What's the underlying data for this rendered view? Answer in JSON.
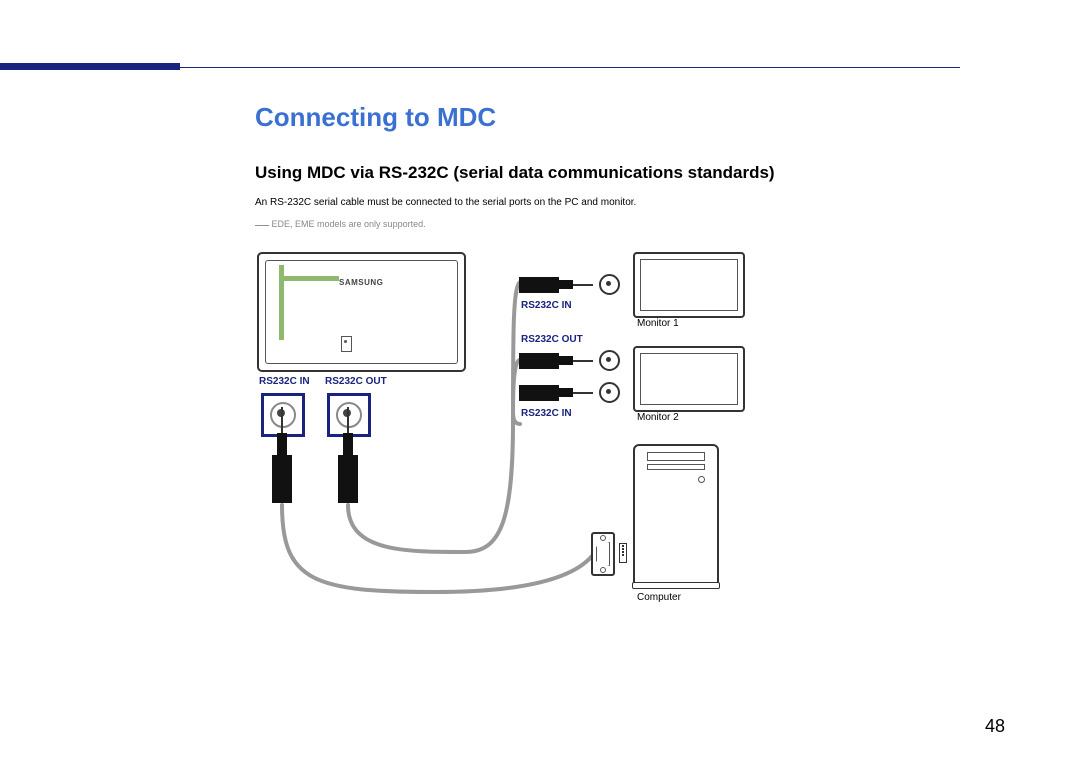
{
  "page": {
    "number": "48",
    "title": "Connecting to MDC",
    "subtitle": "Using MDC via RS-232C (serial data communications standards)",
    "body": "An RS-232C serial cable must be connected to the serial ports on the PC and monitor.",
    "note_prefix": "―",
    "note": "EDE, EME models are only supported.",
    "brand": "SAMSUNG"
  },
  "diagram": {
    "left_in": "RS232C IN",
    "left_out": "RS232C OUT",
    "mid_in_top": "RS232C IN",
    "mid_out": "RS232C OUT",
    "mid_in_bot": "RS232C IN",
    "monitor1": "Monitor 1",
    "monitor2": "Monitor 2",
    "computer": "Computer"
  }
}
